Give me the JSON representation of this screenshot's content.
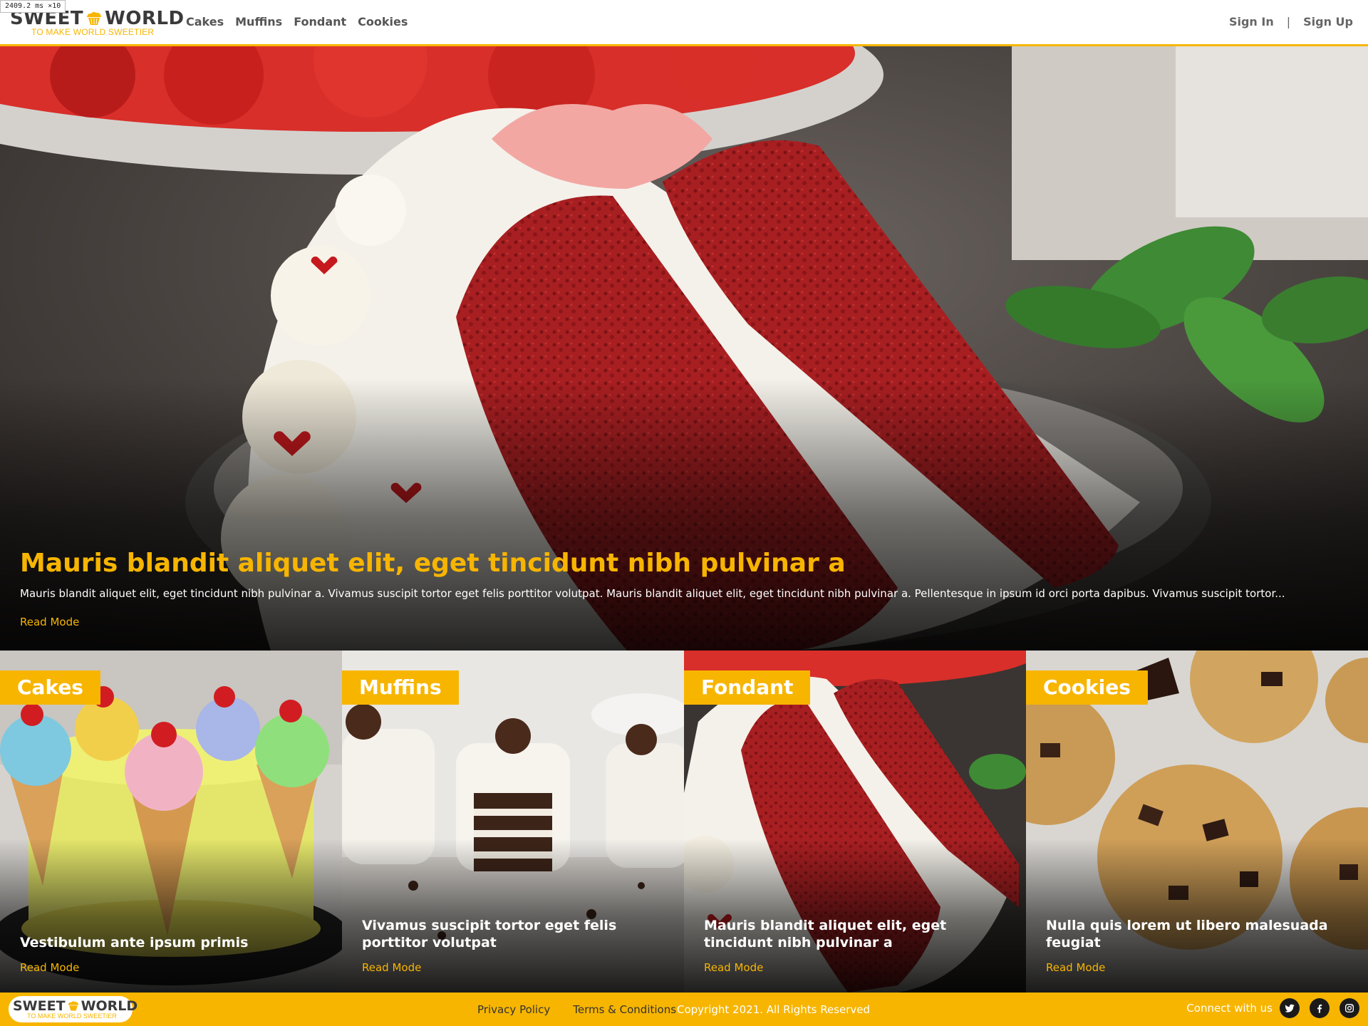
{
  "perf_badge": "2409.2 ms ×10",
  "brand": {
    "name_left": "SWEET",
    "name_right": "WORLD",
    "tagline": "TO MAKE WORLD SWEETIER",
    "accent_color": "#f7b500"
  },
  "nav": {
    "items": [
      {
        "label": "Cakes"
      },
      {
        "label": "Muffins"
      },
      {
        "label": "Fondant"
      },
      {
        "label": "Cookies"
      }
    ]
  },
  "auth": {
    "sign_in": "Sign In",
    "separator": "|",
    "sign_up": "Sign Up"
  },
  "hero": {
    "title": "Mauris blandit aliquet elit, eget tincidunt nibh pulvinar a",
    "excerpt": "Mauris blandit aliquet elit, eget tincidunt nibh pulvinar a. Vivamus suscipit tortor eget felis porttitor volutpat. Mauris blandit aliquet elit, eget tincidunt nibh pulvinar a. Pellentesque in ipsum id orci porta dapibus. Vivamus suscipit tortor...",
    "read_more": "Read Mode"
  },
  "cards": [
    {
      "tag": "Cakes",
      "title": "Vestibulum ante ipsum primis",
      "read_more": "Read Mode"
    },
    {
      "tag": "Muffins",
      "title": "Vivamus suscipit tortor eget felis porttitor volutpat",
      "read_more": "Read Mode"
    },
    {
      "tag": "Fondant",
      "title": "Mauris blandit aliquet elit, eget tincidunt nibh pulvinar a",
      "read_more": "Read Mode"
    },
    {
      "tag": "Cookies",
      "title": "Nulla quis lorem ut libero malesuada feugiat",
      "read_more": "Read Mode"
    }
  ],
  "footer": {
    "privacy": "Privacy Policy",
    "terms": "Terms & Conditions",
    "copyright": "Copyright 2021. All Rights Reserved",
    "connect": "Connect with us",
    "social": [
      {
        "icon": "twitter-icon"
      },
      {
        "icon": "facebook-icon"
      },
      {
        "icon": "instagram-icon"
      }
    ]
  }
}
